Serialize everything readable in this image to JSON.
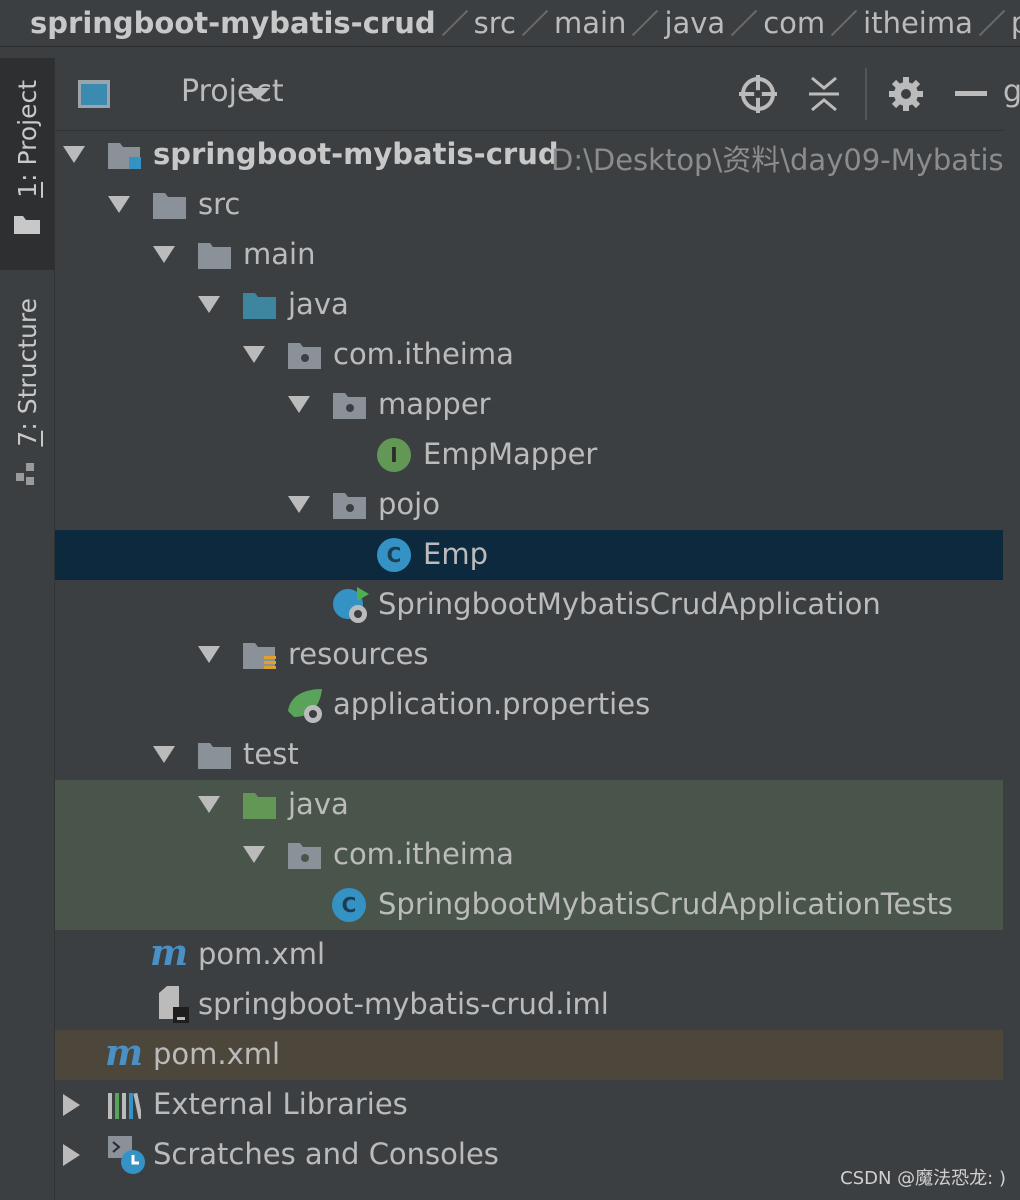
{
  "breadcrumb": [
    "springboot-mybatis-crud",
    "src",
    "main",
    "java",
    "com",
    "itheima",
    "po"
  ],
  "tool_strip": {
    "project_tab": {
      "num": "1",
      "label": ": Project"
    },
    "structure_tab": {
      "num": "7",
      "label": ": Structure"
    }
  },
  "header": {
    "title": "Project",
    "icons": [
      "locate-icon",
      "collapse-all-icon",
      "gear-icon",
      "minimize-icon"
    ],
    "clipped_tab": "g"
  },
  "tree": {
    "root": {
      "label": "springboot-mybatis-crud",
      "path": "D:\\Desktop\\资料\\day09-Mybatis"
    },
    "src": "src",
    "main": "main",
    "main_java": "java",
    "main_pkg": "com.itheima",
    "mapper": "mapper",
    "emp_mapper": "EmpMapper",
    "pojo": "pojo",
    "emp": "Emp",
    "app": "SpringbootMybatisCrudApplication",
    "resources": "resources",
    "app_props": "application.properties",
    "test": "test",
    "test_java": "java",
    "test_pkg": "com.itheima",
    "app_tests": "SpringbootMybatisCrudApplicationTests",
    "module_pom": "pom.xml",
    "iml": "springboot-mybatis-crud.iml",
    "root_pom": "pom.xml",
    "ext_libs": "External Libraries",
    "scratches": "Scratches and Consoles"
  },
  "icon_letters": {
    "interface": "I",
    "class": "C"
  },
  "watermark": "CSDN @魔法恐龙: )",
  "colors": {
    "background": "#3c3f41",
    "selection": "#0d293e",
    "test_source": "#49544a",
    "highlight": "#4d473b",
    "folder": "#8a9199",
    "source_folder": "#3e86a0",
    "test_folder": "#629755",
    "class_icon": "#3592c4",
    "interface_icon": "#629755"
  }
}
